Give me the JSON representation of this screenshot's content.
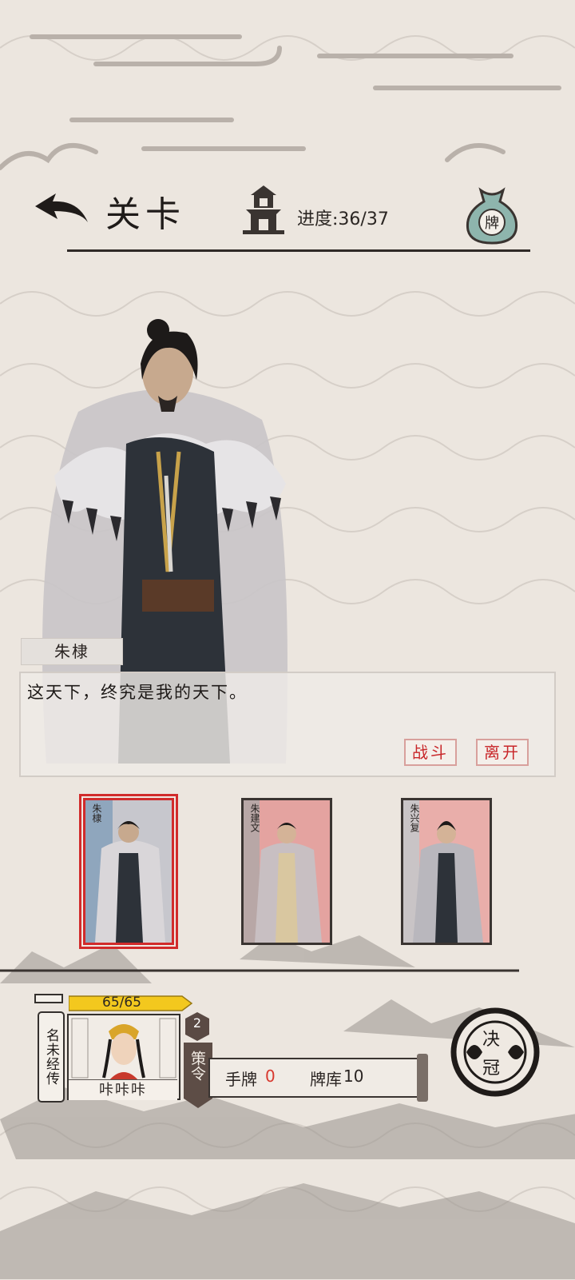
{
  "header": {
    "title": "关卡",
    "progress_label": "进度:",
    "progress_value": "36/37",
    "bag_label": "牌"
  },
  "character": {
    "name": "朱棣",
    "dialog": "这天下，终究是我的天下。"
  },
  "actions": {
    "fight": "战斗",
    "leave": "离开"
  },
  "cards": [
    {
      "name": "朱棣",
      "selected": true,
      "bg": "#8fa6bd"
    },
    {
      "name": "朱建文",
      "selected": false,
      "bg": "#e4a3a0"
    },
    {
      "name": "朱兴复",
      "selected": false,
      "bg": "#e9aeaa"
    }
  ],
  "player": {
    "hp": "65/65",
    "title_flag": "名未经传",
    "name": "咔咔咔",
    "level": "2",
    "strategy_label": "策令",
    "hand_label": "手牌",
    "hand_count": "0",
    "deck_label": "牌库",
    "deck_count": "10",
    "duel_label": "决",
    "duel_label2": "冠"
  },
  "colors": {
    "accent_red": "#c8272a",
    "hp_yellow": "#f3c81e",
    "ink": "#2a2422",
    "paper": "#ece6df"
  }
}
